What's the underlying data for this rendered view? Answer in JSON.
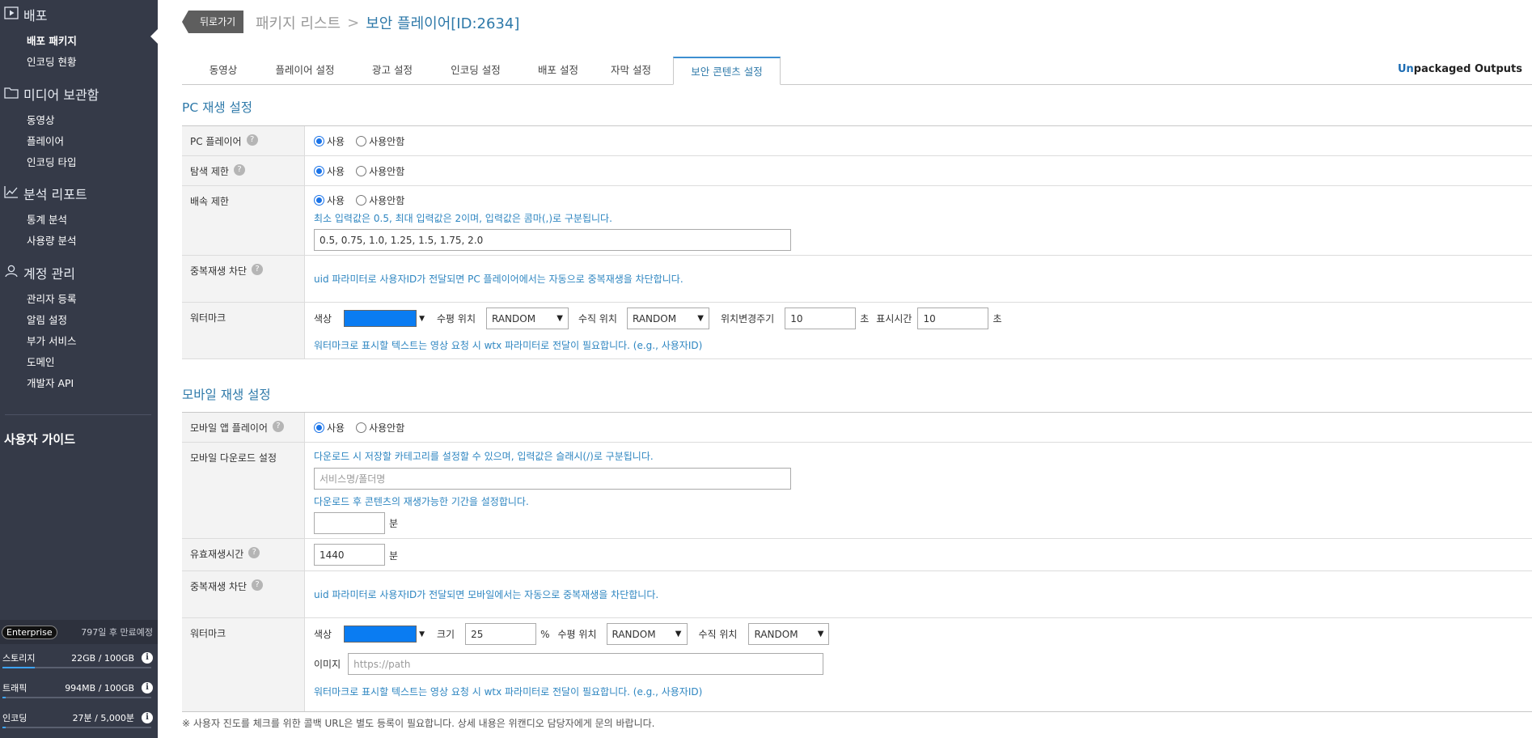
{
  "sidebar": {
    "sections": [
      {
        "title": "배포",
        "icon": "play-icon",
        "items": [
          "배포 패키지",
          "인코딩 현황"
        ]
      },
      {
        "title": "미디어 보관함",
        "icon": "folder-icon",
        "items": [
          "동영상",
          "플레이어",
          "인코딩 타입"
        ]
      },
      {
        "title": "분석 리포트",
        "icon": "chart-icon",
        "items": [
          "통계 분석",
          "사용량 분석"
        ]
      },
      {
        "title": "계정 관리",
        "icon": "user-icon",
        "items": [
          "관리자 등록",
          "알림 설정",
          "부가 서비스",
          "도메인",
          "개발자 API"
        ]
      }
    ],
    "guide": "사용자 가이드",
    "plan": {
      "name": "Enterprise",
      "expiry": "797일 후 만료예정"
    },
    "usage": [
      {
        "label": "스토리지",
        "value": "22GB / 100GB",
        "fraction": 0.22
      },
      {
        "label": "트래픽",
        "value": "994MB / 100GB",
        "fraction": 0.01
      },
      {
        "label": "인코딩",
        "value": "27분 / 5,000분",
        "fraction": 0.01
      }
    ]
  },
  "header": {
    "back": "뒤로가기",
    "crumb_parent": "패키지 리스트",
    "crumb_sep": ">",
    "crumb_current": "보안 플레이어[ID:2634]"
  },
  "tabs": [
    "동영상",
    "플레이어 설정",
    "광고 설정",
    "인코딩 설정",
    "배포 설정",
    "자막 설정",
    "보안 콘텐츠 설정"
  ],
  "unpackaged": {
    "first": "Un",
    "rest": "packaged Outputs"
  },
  "pc": {
    "title": "PC 재생 설정",
    "use": "사용",
    "nouse": "사용안함",
    "player_label": "PC 플레이어",
    "seek_label": "탐색 제한",
    "speed_label": "배속 제한",
    "speed_note": "최소 입력값은 0.5, 최대 입력값은 2이며, 입력값은 콤마(,)로 구분됩니다.",
    "speed_value": "0.5, 0.75, 1.0, 1.25, 1.5, 1.75, 2.0",
    "dup_label": "중복재생 차단",
    "dup_note": "uid 파라미터로 사용자ID가 전달되면 PC 플레이어에서는 자동으로 중복재생을 차단합니다.",
    "wm_label": "워터마크",
    "color_label": "색상",
    "hpos_label": "수평 위치",
    "hpos_value": "RANDOM",
    "vpos_label": "수직 위치",
    "vpos_value": "RANDOM",
    "interval_label": "위치변경주기",
    "interval_value": "10",
    "sec_unit": "초",
    "display_label": "표시시간",
    "display_value": "10",
    "wm_note": "워터마크로 표시할 텍스트는 영상 요청 시 wtx 파라미터로 전달이 필요합니다. (e.g., 사용자ID)",
    "wm_color": "#0a7cf2"
  },
  "mobile": {
    "title": "모바일 재생 설정",
    "use": "사용",
    "nouse": "사용안함",
    "app_label": "모바일 앱 플레이어",
    "dl_label": "모바일 다운로드 설정",
    "dl_note1": "다운로드 시 저장할 카테고리를 설정할 수 있으며, 입력값은 슬래시(/)로 구분됩니다.",
    "dl_placeholder": "서비스명/폴더명",
    "dl_note2": "다운로드 후 콘텐츠의 재생가능한 기간을 설정합니다.",
    "dl_period_value": "",
    "min_unit": "분",
    "valid_label": "유효재생시간",
    "valid_value": "1440",
    "dup_label": "중복재생 차단",
    "dup_note": "uid 파라미터로 사용자ID가 전달되면 모바일에서는 자동으로 중복재생을 차단합니다.",
    "wm_label": "워터마크",
    "color_label": "색상",
    "size_label": "크기",
    "size_value": "25",
    "pct_unit": "%",
    "hpos_label": "수평 위치",
    "hpos_value": "RANDOM",
    "vpos_label": "수직 위치",
    "vpos_value": "RANDOM",
    "image_label": "이미지",
    "image_placeholder": "https://path",
    "wm_note": "워터마크로 표시할 텍스트는 영상 요청 시 wtx 파라미터로 전달이 필요합니다. (e.g., 사용자ID)"
  },
  "footnote": "※ 사용자 진도를 체크를 위한 콜백 URL은 별도 등록이 필요합니다. 상세 내용은 위캔디오 담당자에게 문의 바랍니다."
}
